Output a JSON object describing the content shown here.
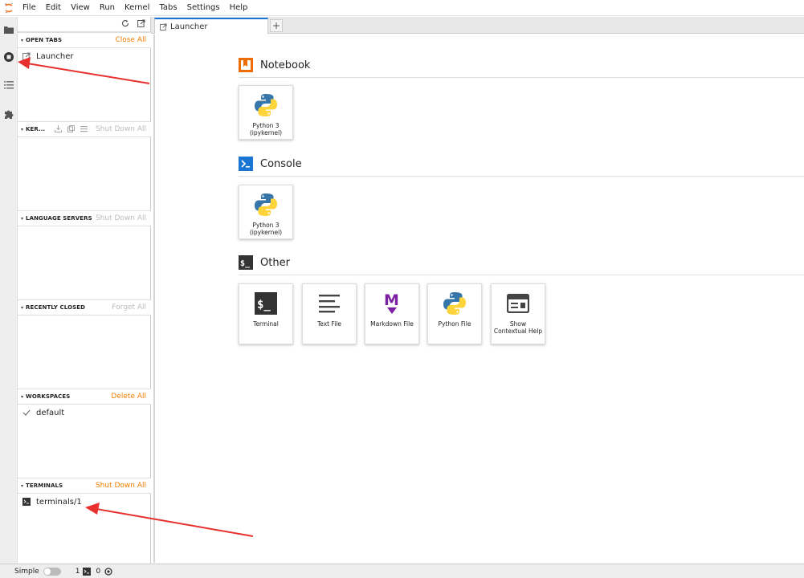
{
  "menu": [
    "File",
    "Edit",
    "View",
    "Run",
    "Kernel",
    "Tabs",
    "Settings",
    "Help"
  ],
  "sidebar": {
    "sections": {
      "open_tabs": {
        "title": "OPEN TABS",
        "action": "Close All",
        "items": [
          "Launcher"
        ]
      },
      "kernels": {
        "title": "KER...",
        "action": "Shut Down All"
      },
      "language_servers": {
        "title": "LANGUAGE SERVERS",
        "action": "Shut Down All"
      },
      "recently_closed": {
        "title": "RECENTLY CLOSED",
        "action": "Forget All"
      },
      "workspaces": {
        "title": "WORKSPACES",
        "action": "Delete All",
        "items": [
          "default"
        ]
      },
      "terminals": {
        "title": "TERMINALS",
        "action": "Shut Down All",
        "items": [
          "terminals/1"
        ]
      }
    }
  },
  "tabs": [
    {
      "label": "Launcher",
      "active": true
    }
  ],
  "launcher": {
    "notebook": {
      "title": "Notebook",
      "cards": [
        {
          "label": "Python 3 (ipykernel)",
          "icon": "python-logo-icon"
        }
      ]
    },
    "console": {
      "title": "Console",
      "cards": [
        {
          "label": "Python 3 (ipykernel)",
          "icon": "python-logo-icon"
        }
      ]
    },
    "other": {
      "title": "Other",
      "cards": [
        {
          "label": "Terminal",
          "icon": "terminal-icon"
        },
        {
          "label": "Text File",
          "icon": "text-lines-icon"
        },
        {
          "label": "Markdown File",
          "icon": "markdown-icon"
        },
        {
          "label": "Python File",
          "icon": "python-logo-icon"
        },
        {
          "label": "Show Contextual Help",
          "icon": "contextual-help-icon"
        }
      ]
    }
  },
  "statusbar": {
    "mode": "Simple",
    "terminal_count": "1",
    "kernel_count": "0"
  },
  "colors": {
    "accent": "#f57c00",
    "tab_active": "#1976d2",
    "annotation_arrow": "#e8312f"
  }
}
